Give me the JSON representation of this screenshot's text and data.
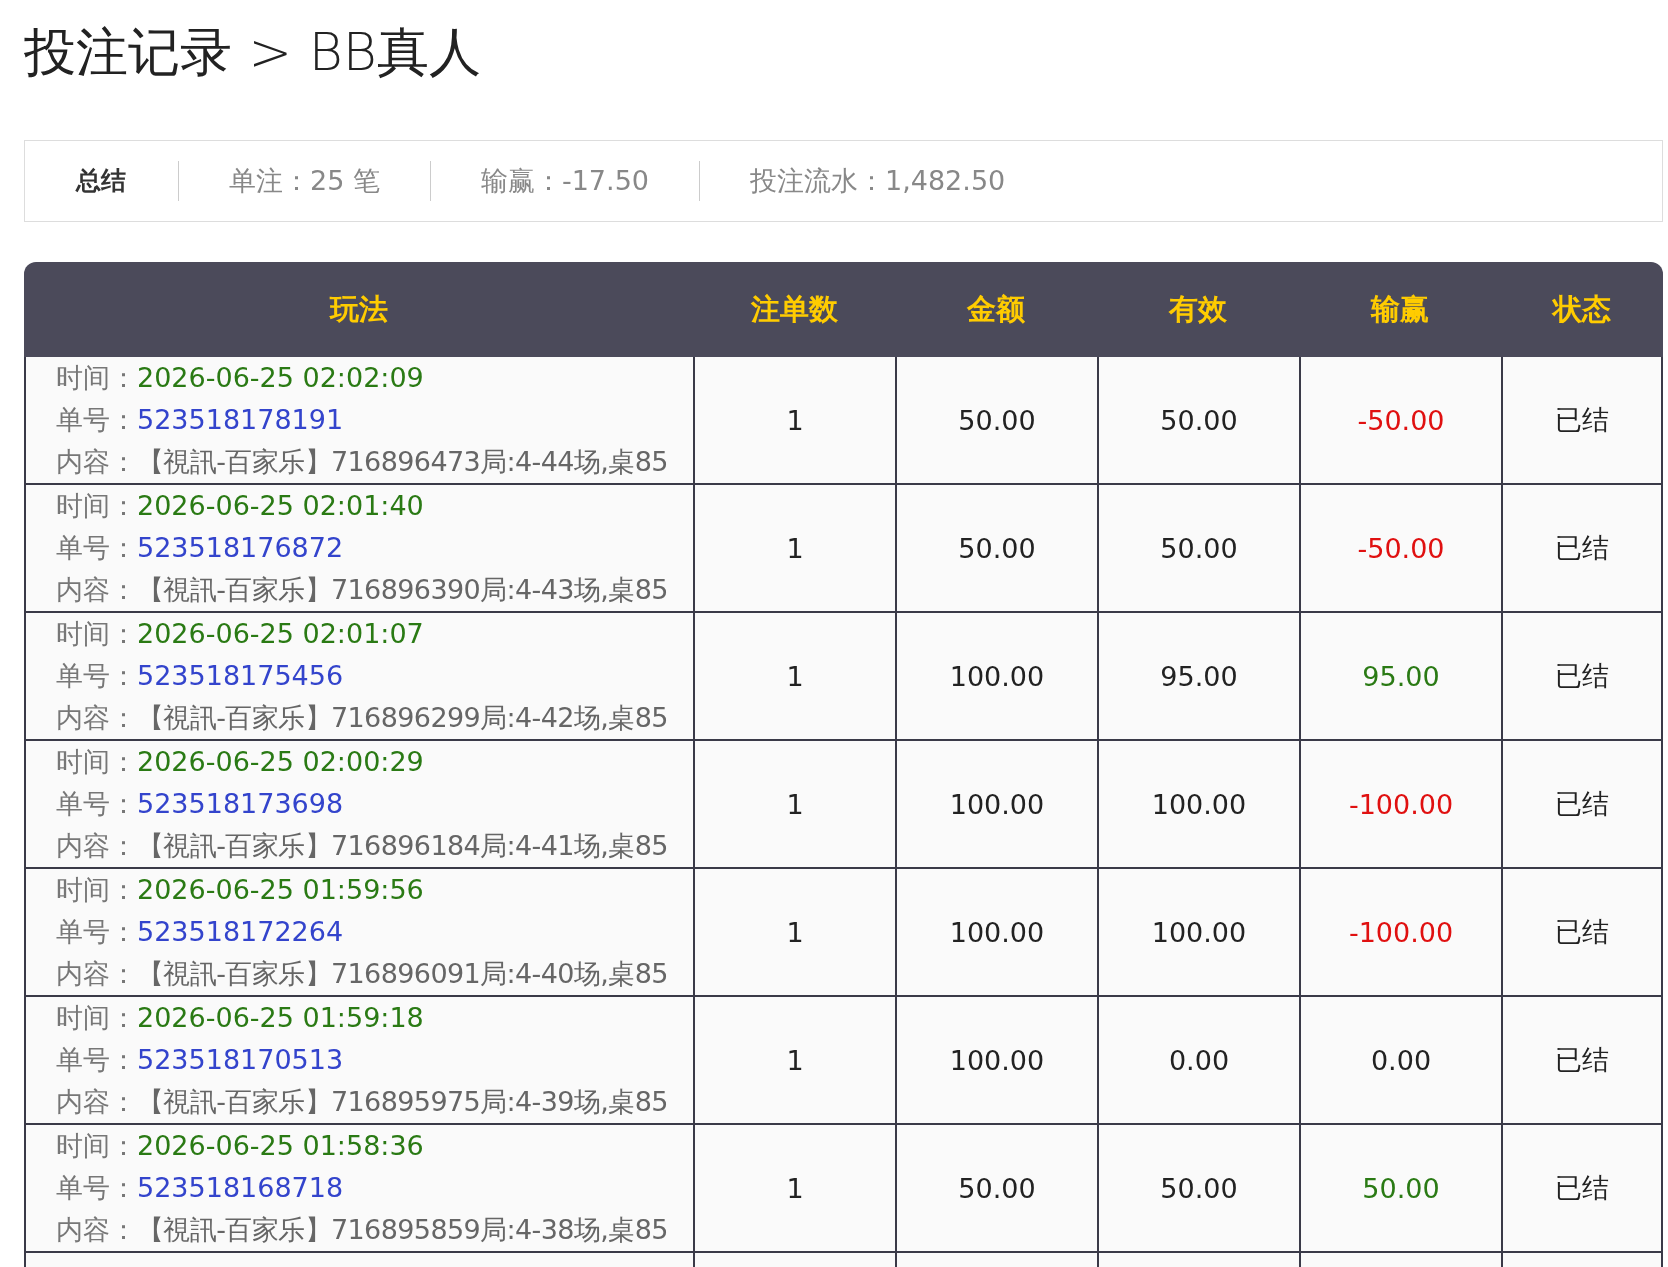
{
  "title": "投注记录 > BB真人",
  "summary": {
    "label": "总结",
    "items": [
      "单注：25 笔",
      "输赢：-17.50",
      "投注流水：1,482.50"
    ]
  },
  "table": {
    "columns": [
      "玩法",
      "注单数",
      "金额",
      "有效",
      "输赢",
      "状态"
    ],
    "rows": [
      {
        "time_label": "时间：",
        "time": "2026-06-25 02:02:09",
        "id_label": "单号：",
        "id": "523518178191",
        "content_label": "内容：",
        "content": "【視訊-百家乐】716896473局:4-44场,桌85",
        "count": "1",
        "amount": "50.00",
        "valid": "50.00",
        "result": "-50.00",
        "kind": "loss",
        "status": "已结"
      },
      {
        "time_label": "时间：",
        "time": "2026-06-25 02:01:40",
        "id_label": "单号：",
        "id": "523518176872",
        "content_label": "内容：",
        "content": "【視訊-百家乐】716896390局:4-43场,桌85",
        "count": "1",
        "amount": "50.00",
        "valid": "50.00",
        "result": "-50.00",
        "kind": "loss",
        "status": "已结"
      },
      {
        "time_label": "时间：",
        "time": "2026-06-25 02:01:07",
        "id_label": "单号：",
        "id": "523518175456",
        "content_label": "内容：",
        "content": "【視訊-百家乐】716896299局:4-42场,桌85",
        "count": "1",
        "amount": "100.00",
        "valid": "95.00",
        "result": "95.00",
        "kind": "win",
        "status": "已结"
      },
      {
        "time_label": "时间：",
        "time": "2026-06-25 02:00:29",
        "id_label": "单号：",
        "id": "523518173698",
        "content_label": "内容：",
        "content": "【視訊-百家乐】716896184局:4-41场,桌85",
        "count": "1",
        "amount": "100.00",
        "valid": "100.00",
        "result": "-100.00",
        "kind": "loss",
        "status": "已结"
      },
      {
        "time_label": "时间：",
        "time": "2026-06-25 01:59:56",
        "id_label": "单号：",
        "id": "523518172264",
        "content_label": "内容：",
        "content": "【視訊-百家乐】716896091局:4-40场,桌85",
        "count": "1",
        "amount": "100.00",
        "valid": "100.00",
        "result": "-100.00",
        "kind": "loss",
        "status": "已结"
      },
      {
        "time_label": "时间：",
        "time": "2026-06-25 01:59:18",
        "id_label": "单号：",
        "id": "523518170513",
        "content_label": "内容：",
        "content": "【視訊-百家乐】716895975局:4-39场,桌85",
        "count": "1",
        "amount": "100.00",
        "valid": "0.00",
        "result": "0.00",
        "kind": "even",
        "status": "已结"
      },
      {
        "time_label": "时间：",
        "time": "2026-06-25 01:58:36",
        "id_label": "单号：",
        "id": "523518168718",
        "content_label": "内容：",
        "content": "【視訊-百家乐】716895859局:4-38场,桌85",
        "count": "1",
        "amount": "50.00",
        "valid": "50.00",
        "result": "50.00",
        "kind": "win",
        "status": "已结"
      }
    ]
  }
}
